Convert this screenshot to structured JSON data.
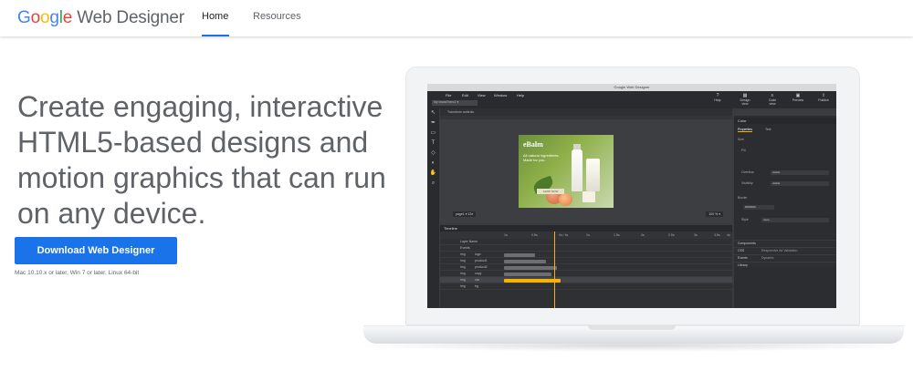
{
  "header": {
    "logo_word_parts": [
      "G",
      "o",
      "o",
      "g",
      "l",
      "e"
    ],
    "logo_product": "Web Designer",
    "nav": [
      {
        "label": "Home",
        "active": true
      },
      {
        "label": "Resources",
        "active": false
      }
    ]
  },
  "hero": {
    "headline": "Create engaging, interactive HTML5-based designs and motion graphics that can run on any device.",
    "download_label": "Download Web Designer",
    "requirements": "Mac 10.10.x or later, Win 7 or later, Linux 64-bit"
  },
  "colors": {
    "accent": "#1a73e8",
    "google_blue": "#4285F4",
    "google_red": "#EA4335",
    "google_yellow": "#FBBC05",
    "google_green": "#34A853",
    "text_gray": "#5f6368",
    "playhead": "#f5b400"
  },
  "app": {
    "window_title": "Google Web Designer",
    "menu": [
      "File",
      "Edit",
      "View",
      "Window",
      "Help"
    ],
    "document_select": "My brand hero1 ▾",
    "toolbar_right": [
      "Help",
      "Design view",
      "Code view",
      "Preview",
      "Publish"
    ],
    "toolrow_label": "Transform controls",
    "page_label": "page1 ▾  12e",
    "zoom_label": "100 % ▾",
    "ad": {
      "brand": "eBalm",
      "tagline": "All natural ingredients. Made for you.",
      "cta": "SHOP NOW"
    },
    "timeline": {
      "title": "Timeline",
      "scale": [
        "1s",
        "0.5s",
        "1s",
        "1.5s",
        "2s",
        "2.5s",
        "3s",
        "3.5s",
        "4s"
      ],
      "time_readout": "0s / 4s",
      "rows": [
        {
          "name": "Layer Name",
          "sub": ""
        },
        {
          "name": "Events",
          "sub": ""
        },
        {
          "name": "img",
          "sub": "logo"
        },
        {
          "name": "img",
          "sub": "product1"
        },
        {
          "name": "img",
          "sub": "product2"
        },
        {
          "name": "img",
          "sub": "copy"
        },
        {
          "name": "img",
          "sub": "cta"
        },
        {
          "name": "img",
          "sub": "bg"
        }
      ]
    },
    "panel": {
      "color_section": "Color",
      "tabs": [
        "Properties",
        "Text"
      ],
      "size_label": "Size",
      "fill_label": "Fill",
      "overflow_label": "Overflow",
      "overflow_value": "visible",
      "visibility_label": "Visibility",
      "visibility_value": "visible",
      "border_label": "Border",
      "border_value": "#000000",
      "style_label": "Style",
      "style_value": "none",
      "bottom_sections": [
        {
          "label": "Components",
          "sub": ""
        },
        {
          "label": "CSS",
          "sub": "Responsive    Ad Validation"
        },
        {
          "label": "Events",
          "sub": "Dynamic"
        },
        {
          "label": "Library",
          "sub": ""
        }
      ]
    }
  }
}
